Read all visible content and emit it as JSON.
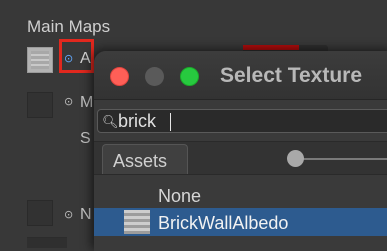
{
  "inspector": {
    "section_title": "Main Maps",
    "albedo_label": "A",
    "metallic_label": "M",
    "smoothness_label": "S",
    "normal_label": "N",
    "picker_glyph": "⊙",
    "albedo_color": "#b00c0c"
  },
  "window": {
    "title": "Select Texture",
    "search": {
      "value": "brick",
      "icon": "search-icon"
    },
    "tabs": [
      "Assets"
    ],
    "items": [
      {
        "label": "None",
        "selected": false
      },
      {
        "label": "BrickWallAlbedo",
        "selected": true
      }
    ],
    "accent_color": "#2d5b8f"
  }
}
